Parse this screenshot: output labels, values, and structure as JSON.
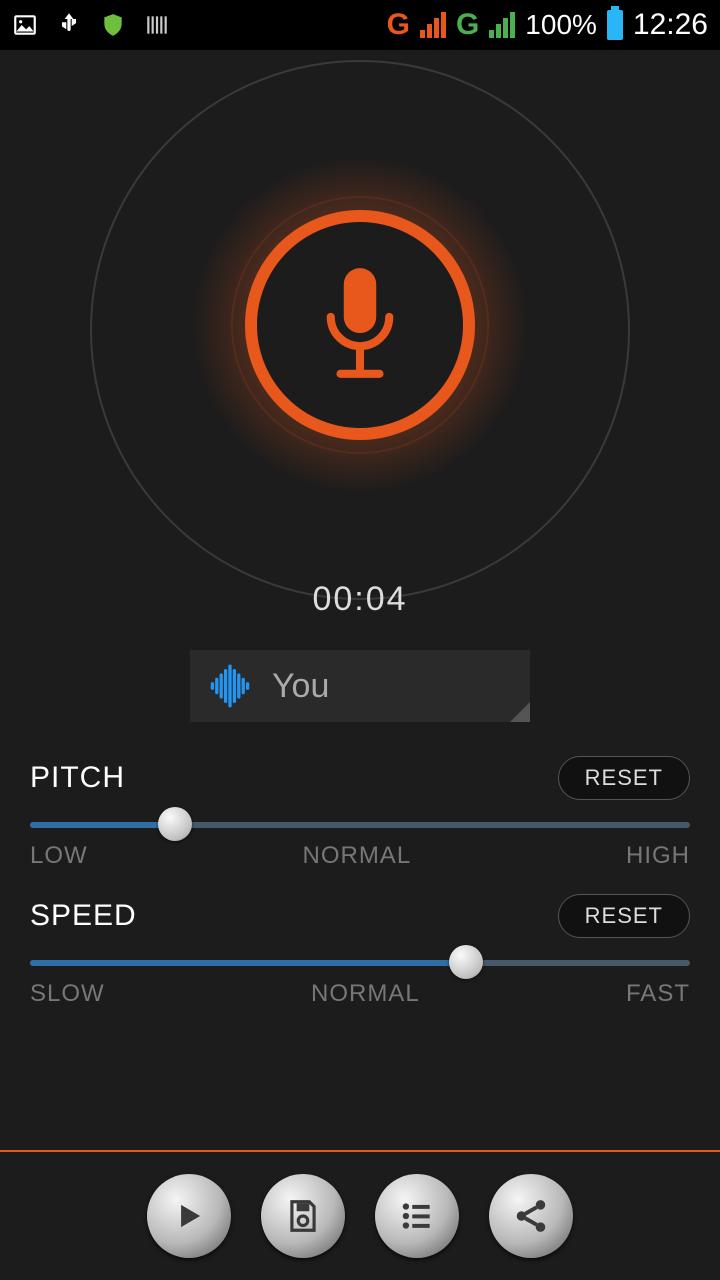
{
  "status_bar": {
    "network1_label": "G",
    "network2_label": "G",
    "battery": "100%",
    "time": "12:26"
  },
  "recorder": {
    "timer": "00:04"
  },
  "voice_select": {
    "name": "You"
  },
  "pitch": {
    "title": "PITCH",
    "reset_label": "RESET",
    "label_low": "LOW",
    "label_mid": "NORMAL",
    "label_high": "HIGH",
    "value_percent": 22
  },
  "speed": {
    "title": "SPEED",
    "reset_label": "RESET",
    "label_low": "SLOW",
    "label_mid": "NORMAL",
    "label_high": "FAST",
    "value_percent": 66
  },
  "icons": {
    "play": "play-icon",
    "save": "save-icon",
    "list": "list-icon",
    "share": "share-icon",
    "mic": "microphone-icon",
    "waveform": "waveform-icon"
  }
}
